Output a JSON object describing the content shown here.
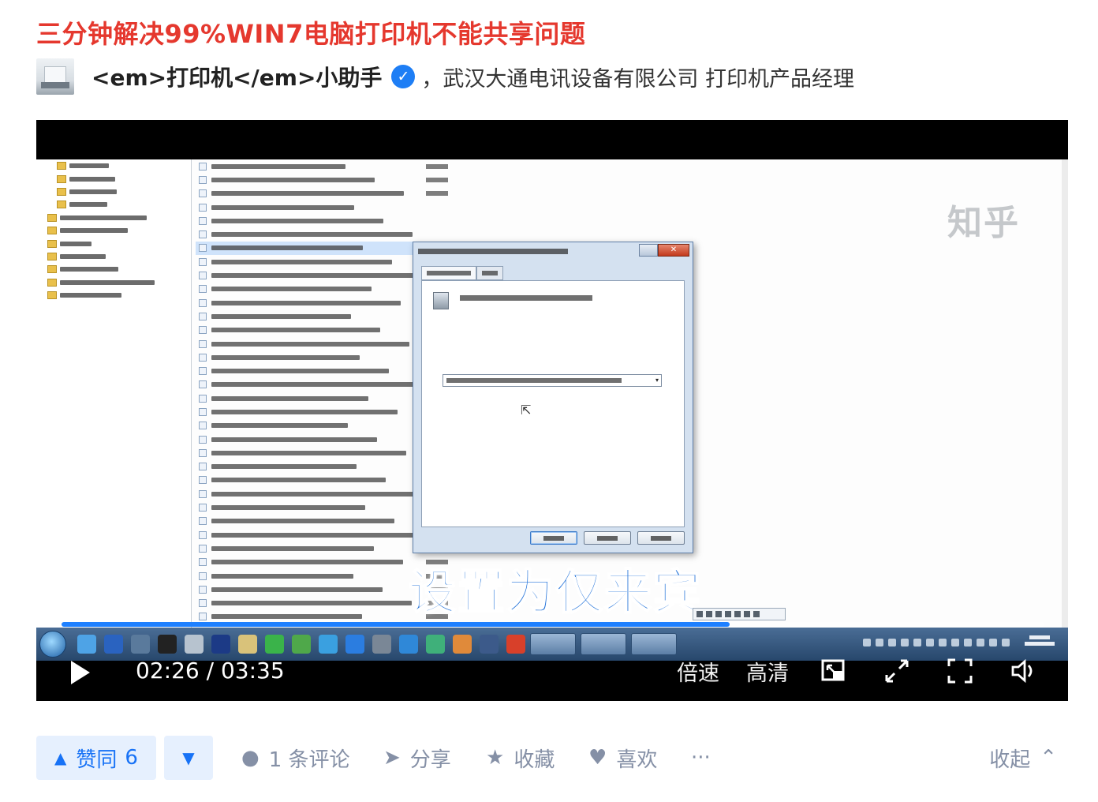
{
  "article": {
    "title": "三分钟解决99%WIN7电脑打印机不能共享问题"
  },
  "author": {
    "name": "<em>打印机</em>小助手",
    "verified_glyph": "✓",
    "description": "，武汉大通电讯设备有限公司 打印机产品经理"
  },
  "video": {
    "watermark": "知乎",
    "subtitle": "设置为仅来宾",
    "current_time": "02:26",
    "separator": " / ",
    "duration": "03:35",
    "progress": 0.68,
    "speed_label": "倍速",
    "quality_label": "高清",
    "icons": [
      "play-icon",
      "picture-in-picture-icon",
      "web-fullscreen-icon",
      "fullscreen-icon",
      "volume-icon"
    ]
  },
  "actions": {
    "upvote_arrow": "▲",
    "upvote_label": "赞同",
    "upvote_count": "6",
    "downvote_arrow": "▼",
    "comment_icon": "●",
    "comment_label": "1 条评论",
    "share_icon": "➤",
    "share_label": "分享",
    "favorite_icon": "★",
    "favorite_label": "收藏",
    "like_icon": "♥",
    "like_label": "喜欢",
    "more_label": "···",
    "collapse_label": "收起",
    "collapse_icon": "⌃"
  },
  "colors": {
    "title": "#e5382e",
    "accent": "#1772f6",
    "muted": "#8590a6",
    "progress": "#1e80ff"
  }
}
